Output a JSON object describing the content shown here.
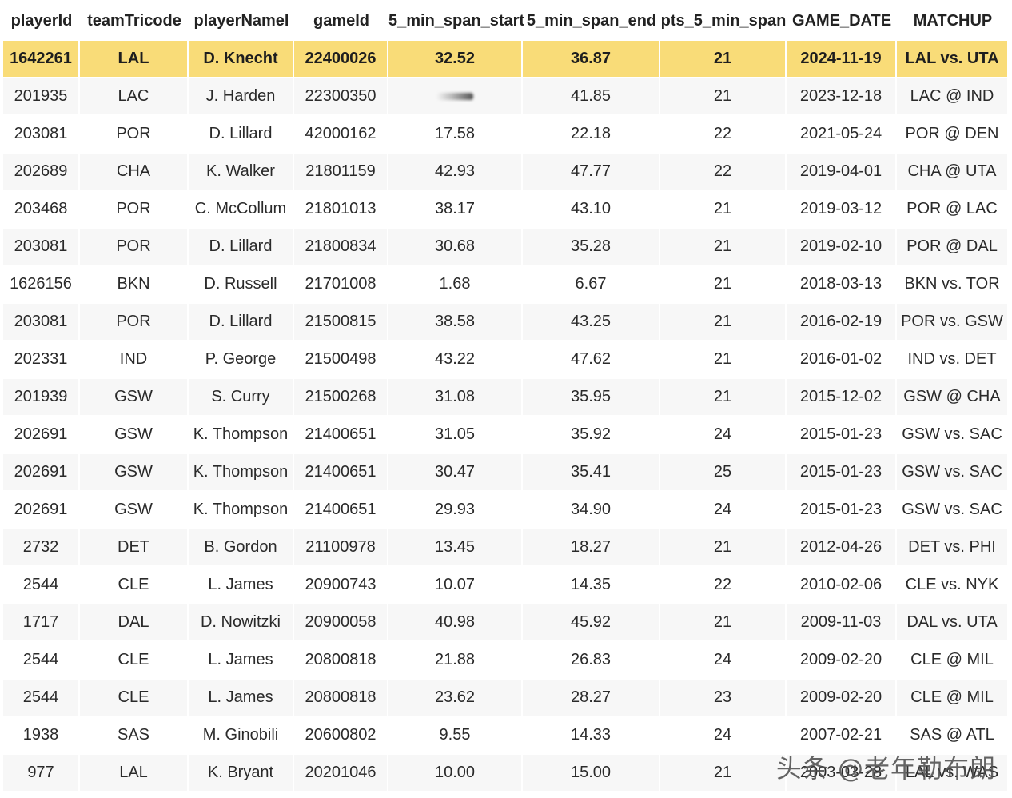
{
  "columns": [
    "playerId",
    "teamTricode",
    "playerNamel",
    "gameId",
    "5_min_span_start",
    "5_min_span_end",
    "pts_5_min_span",
    "GAME_DATE",
    "MATCHUP"
  ],
  "rows": [
    [
      "1642261",
      "LAL",
      "D. Knecht",
      "22400026",
      "32.52",
      "36.87",
      "21",
      "2024-11-19",
      "LAL vs. UTA"
    ],
    [
      "201935",
      "LAC",
      "J. Harden",
      "22300350",
      "",
      "41.85",
      "21",
      "2023-12-18",
      "LAC @ IND"
    ],
    [
      "203081",
      "POR",
      "D. Lillard",
      "42000162",
      "17.58",
      "22.18",
      "22",
      "2021-05-24",
      "POR @ DEN"
    ],
    [
      "202689",
      "CHA",
      "K. Walker",
      "21801159",
      "42.93",
      "47.77",
      "22",
      "2019-04-01",
      "CHA @ UTA"
    ],
    [
      "203468",
      "POR",
      "C. McCollum",
      "21801013",
      "38.17",
      "43.10",
      "21",
      "2019-03-12",
      "POR @ LAC"
    ],
    [
      "203081",
      "POR",
      "D. Lillard",
      "21800834",
      "30.68",
      "35.28",
      "21",
      "2019-02-10",
      "POR @ DAL"
    ],
    [
      "1626156",
      "BKN",
      "D. Russell",
      "21701008",
      "1.68",
      "6.67",
      "21",
      "2018-03-13",
      "BKN vs. TOR"
    ],
    [
      "203081",
      "POR",
      "D. Lillard",
      "21500815",
      "38.58",
      "43.25",
      "21",
      "2016-02-19",
      "POR vs. GSW"
    ],
    [
      "202331",
      "IND",
      "P. George",
      "21500498",
      "43.22",
      "47.62",
      "21",
      "2016-01-02",
      "IND vs. DET"
    ],
    [
      "201939",
      "GSW",
      "S. Curry",
      "21500268",
      "31.08",
      "35.95",
      "21",
      "2015-12-02",
      "GSW @ CHA"
    ],
    [
      "202691",
      "GSW",
      "K. Thompson",
      "21400651",
      "31.05",
      "35.92",
      "24",
      "2015-01-23",
      "GSW vs. SAC"
    ],
    [
      "202691",
      "GSW",
      "K. Thompson",
      "21400651",
      "30.47",
      "35.41",
      "25",
      "2015-01-23",
      "GSW vs. SAC"
    ],
    [
      "202691",
      "GSW",
      "K. Thompson",
      "21400651",
      "29.93",
      "34.90",
      "24",
      "2015-01-23",
      "GSW vs. SAC"
    ],
    [
      "2732",
      "DET",
      "B. Gordon",
      "21100978",
      "13.45",
      "18.27",
      "21",
      "2012-04-26",
      "DET vs. PHI"
    ],
    [
      "2544",
      "CLE",
      "L. James",
      "20900743",
      "10.07",
      "14.35",
      "22",
      "2010-02-06",
      "CLE vs. NYK"
    ],
    [
      "1717",
      "DAL",
      "D. Nowitzki",
      "20900058",
      "40.98",
      "45.92",
      "21",
      "2009-11-03",
      "DAL vs. UTA"
    ],
    [
      "2544",
      "CLE",
      "L. James",
      "20800818",
      "21.88",
      "26.83",
      "24",
      "2009-02-20",
      "CLE @ MIL"
    ],
    [
      "2544",
      "CLE",
      "L. James",
      "20800818",
      "23.62",
      "28.27",
      "23",
      "2009-02-20",
      "CLE @ MIL"
    ],
    [
      "1938",
      "SAS",
      "M. Ginobili",
      "20600802",
      "9.55",
      "14.33",
      "24",
      "2007-02-21",
      "SAS @ ATL"
    ],
    [
      "977",
      "LAL",
      "K. Bryant",
      "20201046",
      "10.00",
      "15.00",
      "21",
      "2003-03-28",
      "LAL vs. WAS"
    ]
  ],
  "highlight_row_index": 0,
  "highlight_color": "#f9dc78",
  "watermark": "头条 @老年勒布朗"
}
